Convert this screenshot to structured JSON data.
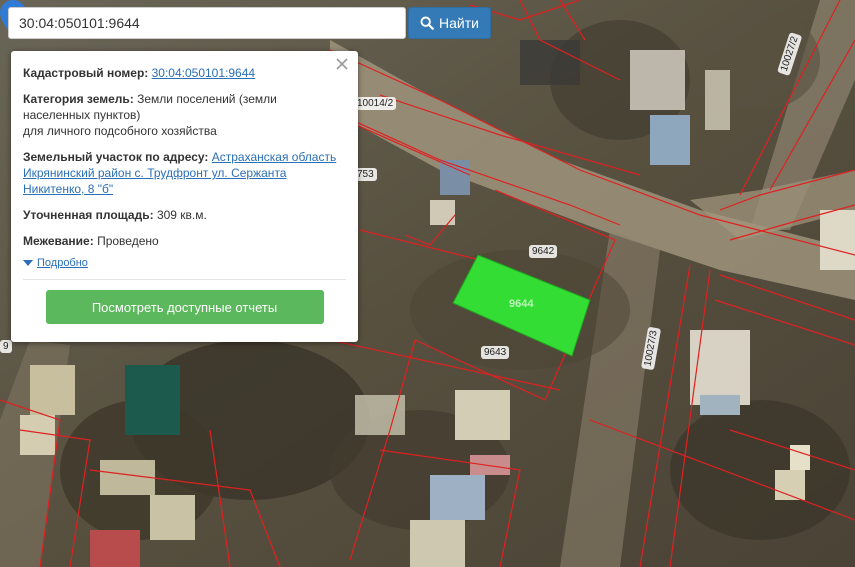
{
  "search": {
    "value": "30:04:050101:9644",
    "button_label": "Найти"
  },
  "popup": {
    "cadastral_label": "Кадастровый номер:",
    "cadastral_value": "30:04:050101:9644",
    "category_label": "Категория земель:",
    "category_value_1": "Земли поселений (земли",
    "category_value_2": "населенных пунктов)",
    "category_value_3": "для личного подсобного хозяйства",
    "address_label": "Земельный участок по адресу:",
    "address_value_1": "Астраханская область",
    "address_value_2": "Икрянинский район с. Трудфронт ул. Сержанта",
    "address_value_3": "Никитенко, 8 \"б\"",
    "area_label": "Уточненная площадь:",
    "area_value": "309 кв.м.",
    "survey_label": "Межевание:",
    "survey_value": "Проведено",
    "details_label": "Подробно",
    "report_button": "Посмотреть доступные отчеты"
  },
  "map": {
    "labels": {
      "l10014": "10014/2",
      "l753": "753",
      "l9642": "9642",
      "l9644": "9644",
      "l9643": "9643",
      "l10027_3": "10027/3",
      "l10027_2": "10027/2",
      "l9": "9"
    },
    "colors": {
      "parcel_fill": "#33dd33",
      "boundary": "#e02020",
      "accent": "#337ab7",
      "button": "#5cb85c"
    },
    "icons": [
      "search-icon",
      "close-icon",
      "map-marker-icon",
      "caret-down-icon"
    ]
  }
}
